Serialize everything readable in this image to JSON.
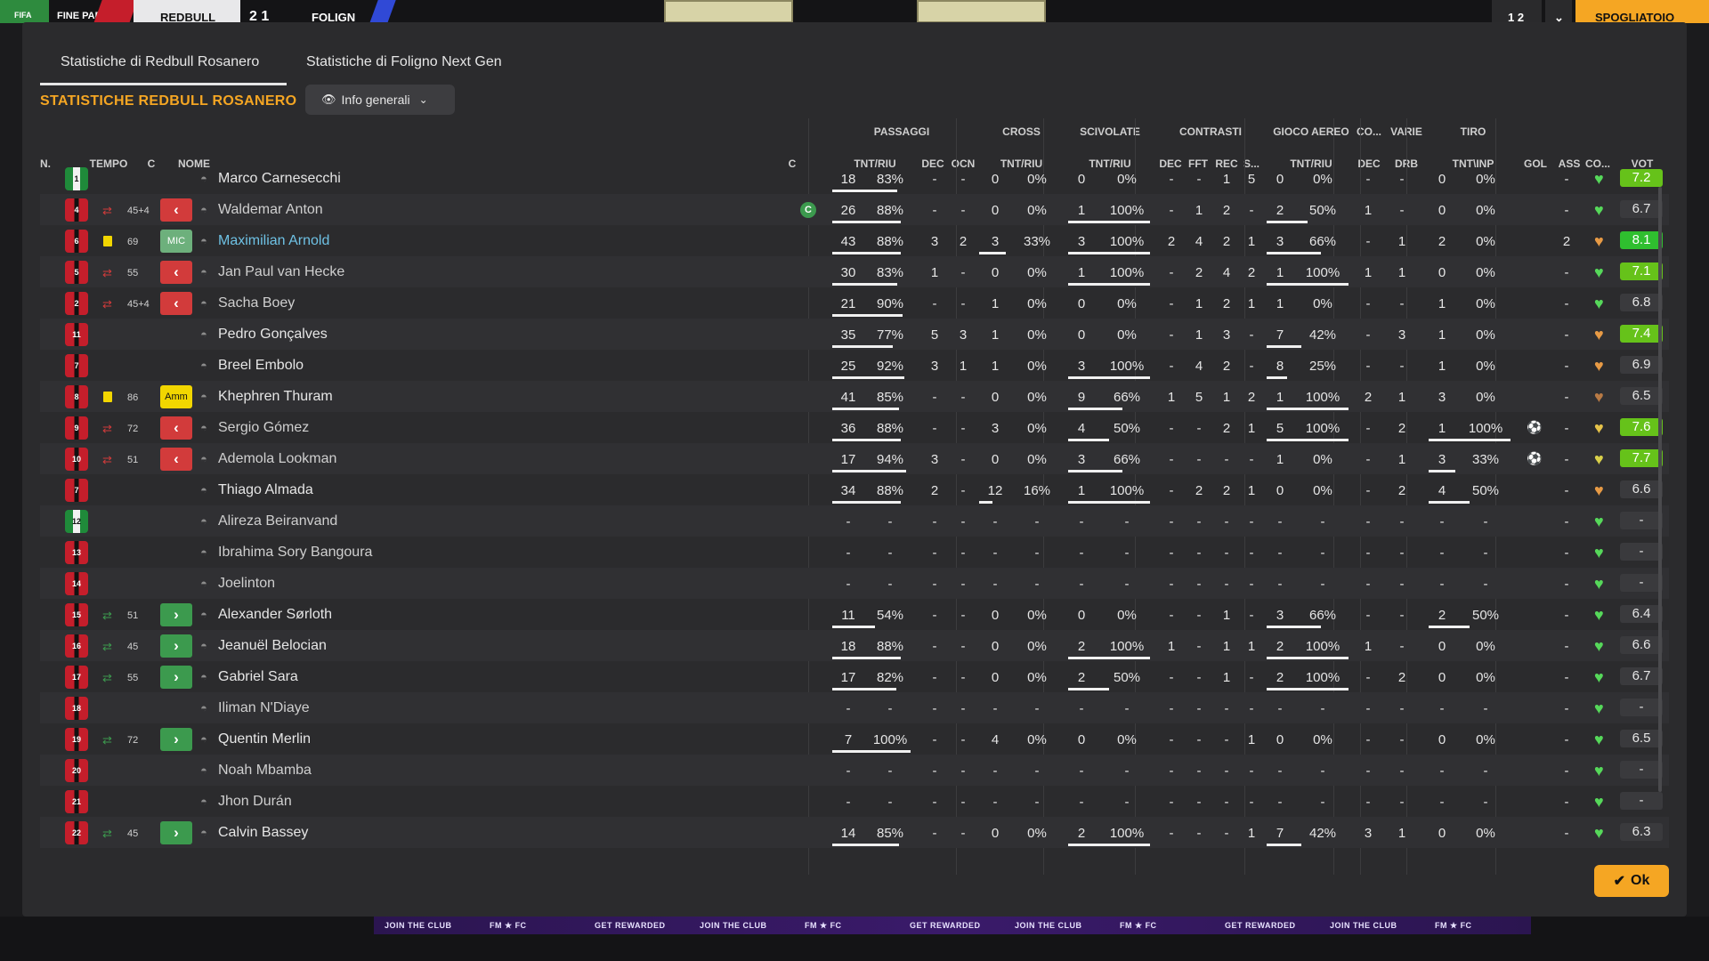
{
  "topbar": {
    "badge": "FIFA",
    "label": "FINE PARTITA",
    "home": "REDBULL",
    "score": "2 1",
    "away": "FOLIGN",
    "right_text": "1 2",
    "right_btn": "SPOGLIATOIO"
  },
  "tabs": [
    "Statistiche di Redbull Rosanero",
    "Statistiche di Foligno Next Gen"
  ],
  "section_title": "STATISTICHE REDBULL ROSANERO",
  "dropdown": {
    "label": "Info generali",
    "icon": "eye-icon"
  },
  "groups": [
    "PASSAGGI",
    "CROSS",
    "SCIVOLATE",
    "CONTRASTI",
    "GIOCO AEREO",
    "CO...",
    "VARIE",
    "TIRO"
  ],
  "columns": [
    "N.",
    "TEMPO",
    "C",
    "NOME",
    "C",
    "TNT/RIU",
    "DEC",
    "OCN",
    "TNT/RIU",
    "TNT/RIU",
    "DEC",
    "FFT",
    "REC",
    "S...",
    "TNT/RIU",
    "DEC",
    "DRB",
    "TNT\\INP",
    "GOL",
    "ASS",
    "CO...",
    "VOT"
  ],
  "players": [
    {
      "n": "1",
      "kit": "gk",
      "sub": "",
      "card": "",
      "min": "",
      "pos": "",
      "pos_style": "",
      "name": "Marco Carnesecchi",
      "name_style": "",
      "capt": "",
      "p1": "18",
      "p2": "83%",
      "pdec": "-",
      "pocn": "-",
      "c1": "0",
      "c2": "0%",
      "s1": "0",
      "s2": "0%",
      "cd": "-",
      "cf": "-",
      "cr": "1",
      "cs": "5",
      "a1": "0",
      "a2": "0%",
      "co": "-",
      "drb": "-",
      "t1": "0",
      "t2": "0%",
      "gol": "",
      "ass": "-",
      "heart": "green",
      "vot": "7.2",
      "vstyle": "good",
      "pbar": 0.83,
      "sbar": 0,
      "abar": 0,
      "tbar": 0,
      "cbar": 0
    },
    {
      "n": "4",
      "kit": "",
      "sub": "out",
      "card": "",
      "min": "45+4",
      "pos": "<",
      "pos_style": "red",
      "name": "Waldemar Anton",
      "name_style": "dim",
      "capt": "C",
      "p1": "26",
      "p2": "88%",
      "pdec": "-",
      "pocn": "-",
      "c1": "0",
      "c2": "0%",
      "s1": "1",
      "s2": "100%",
      "cd": "-",
      "cf": "1",
      "cr": "2",
      "cs": "-",
      "a1": "2",
      "a2": "50%",
      "co": "1",
      "drb": "-",
      "t1": "0",
      "t2": "0%",
      "gol": "",
      "ass": "-",
      "heart": "green",
      "vot": "6.7",
      "vstyle": "",
      "pbar": 0.88,
      "sbar": 1,
      "abar": 0.5,
      "tbar": 0,
      "cbar": 0
    },
    {
      "n": "6",
      "kit": "",
      "sub": "",
      "card": "yellow",
      "min": "69",
      "pos": "MIC",
      "pos_style": "mic",
      "name": "Maximilian Arnold",
      "name_style": "blue",
      "capt": "",
      "p1": "43",
      "p2": "88%",
      "pdec": "3",
      "pocn": "2",
      "c1": "3",
      "c2": "33%",
      "s1": "3",
      "s2": "100%",
      "cd": "2",
      "cf": "4",
      "cr": "2",
      "cs": "1",
      "a1": "3",
      "a2": "66%",
      "co": "-",
      "drb": "1",
      "t1": "2",
      "t2": "0%",
      "gol": "",
      "ass": "2",
      "heart": "orange",
      "vot": "8.1",
      "vstyle": "great",
      "pbar": 0.88,
      "sbar": 1,
      "abar": 0.66,
      "tbar": 0,
      "cbar": 0.33
    },
    {
      "n": "5",
      "kit": "",
      "sub": "out",
      "card": "",
      "min": "55",
      "pos": "<",
      "pos_style": "red",
      "name": "Jan Paul van Hecke",
      "name_style": "dim",
      "capt": "",
      "p1": "30",
      "p2": "83%",
      "pdec": "1",
      "pocn": "-",
      "c1": "0",
      "c2": "0%",
      "s1": "1",
      "s2": "100%",
      "cd": "-",
      "cf": "2",
      "cr": "4",
      "cs": "2",
      "a1": "1",
      "a2": "100%",
      "co": "1",
      "drb": "1",
      "t1": "0",
      "t2": "0%",
      "gol": "",
      "ass": "-",
      "heart": "green",
      "vot": "7.1",
      "vstyle": "good",
      "pbar": 0.83,
      "sbar": 1,
      "abar": 1,
      "tbar": 0,
      "cbar": 0
    },
    {
      "n": "2",
      "kit": "",
      "sub": "out",
      "card": "",
      "min": "45+4",
      "pos": "<",
      "pos_style": "red",
      "name": "Sacha Boey",
      "name_style": "dim",
      "capt": "",
      "p1": "21",
      "p2": "90%",
      "pdec": "-",
      "pocn": "-",
      "c1": "1",
      "c2": "0%",
      "s1": "0",
      "s2": "0%",
      "cd": "-",
      "cf": "1",
      "cr": "2",
      "cs": "1",
      "a1": "1",
      "a2": "0%",
      "co": "-",
      "drb": "-",
      "t1": "1",
      "t2": "0%",
      "gol": "",
      "ass": "-",
      "heart": "green",
      "vot": "6.8",
      "vstyle": "",
      "pbar": 0.9,
      "sbar": 0,
      "abar": 0,
      "tbar": 0,
      "cbar": 0
    },
    {
      "n": "11",
      "kit": "",
      "sub": "",
      "card": "",
      "min": "",
      "pos": "",
      "pos_style": "",
      "name": "Pedro Gonçalves",
      "name_style": "",
      "capt": "",
      "p1": "35",
      "p2": "77%",
      "pdec": "5",
      "pocn": "3",
      "c1": "1",
      "c2": "0%",
      "s1": "0",
      "s2": "0%",
      "cd": "-",
      "cf": "1",
      "cr": "3",
      "cs": "-",
      "a1": "7",
      "a2": "42%",
      "co": "-",
      "drb": "3",
      "t1": "1",
      "t2": "0%",
      "gol": "",
      "ass": "-",
      "heart": "orange",
      "vot": "7.4",
      "vstyle": "good",
      "pbar": 0.77,
      "sbar": 0,
      "abar": 0.42,
      "tbar": 0,
      "cbar": 0
    },
    {
      "n": "7",
      "kit": "",
      "sub": "",
      "card": "",
      "min": "",
      "pos": "",
      "pos_style": "",
      "name": "Breel Embolo",
      "name_style": "",
      "capt": "",
      "p1": "25",
      "p2": "92%",
      "pdec": "3",
      "pocn": "1",
      "c1": "1",
      "c2": "0%",
      "s1": "3",
      "s2": "100%",
      "cd": "-",
      "cf": "4",
      "cr": "2",
      "cs": "-",
      "a1": "8",
      "a2": "25%",
      "co": "-",
      "drb": "-",
      "t1": "1",
      "t2": "0%",
      "gol": "",
      "ass": "-",
      "heart": "orange",
      "vot": "6.9",
      "vstyle": "",
      "pbar": 0.92,
      "sbar": 1,
      "abar": 0.25,
      "tbar": 0,
      "cbar": 0
    },
    {
      "n": "8",
      "kit": "",
      "sub": "",
      "card": "yellow",
      "min": "86",
      "pos": "Amm",
      "pos_style": "amm",
      "name": "Khephren Thuram",
      "name_style": "",
      "capt": "",
      "p1": "41",
      "p2": "85%",
      "pdec": "-",
      "pocn": "-",
      "c1": "0",
      "c2": "0%",
      "s1": "9",
      "s2": "66%",
      "cd": "1",
      "cf": "5",
      "cr": "1",
      "cs": "2",
      "a1": "1",
      "a2": "100%",
      "co": "2",
      "drb": "1",
      "t1": "3",
      "t2": "0%",
      "gol": "",
      "ass": "-",
      "heart": "brown",
      "vot": "6.5",
      "vstyle": "",
      "pbar": 0.85,
      "sbar": 0.66,
      "abar": 1,
      "tbar": 0,
      "cbar": 0
    },
    {
      "n": "9",
      "kit": "",
      "sub": "out",
      "card": "",
      "min": "72",
      "pos": "<",
      "pos_style": "red",
      "name": "Sergio Gómez",
      "name_style": "dim",
      "capt": "",
      "p1": "36",
      "p2": "88%",
      "pdec": "-",
      "pocn": "-",
      "c1": "3",
      "c2": "0%",
      "s1": "4",
      "s2": "50%",
      "cd": "-",
      "cf": "-",
      "cr": "2",
      "cs": "1",
      "a1": "5",
      "a2": "100%",
      "co": "-",
      "drb": "2",
      "t1": "1",
      "t2": "100%",
      "gol": "ball",
      "ass": "-",
      "heart": "gold",
      "vot": "7.6",
      "vstyle": "good",
      "pbar": 0.88,
      "sbar": 0.5,
      "abar": 1,
      "tbar": 1,
      "cbar": 0
    },
    {
      "n": "10",
      "kit": "",
      "sub": "out",
      "card": "",
      "min": "51",
      "pos": "<",
      "pos_style": "red",
      "name": "Ademola Lookman",
      "name_style": "dim",
      "capt": "",
      "p1": "17",
      "p2": "94%",
      "pdec": "3",
      "pocn": "-",
      "c1": "0",
      "c2": "0%",
      "s1": "3",
      "s2": "66%",
      "cd": "-",
      "cf": "-",
      "cr": "-",
      "cs": "-",
      "a1": "1",
      "a2": "0%",
      "co": "-",
      "drb": "1",
      "t1": "3",
      "t2": "33%",
      "gol": "ball",
      "ass": "-",
      "heart": "yellow",
      "vot": "7.7",
      "vstyle": "good",
      "pbar": 0.94,
      "sbar": 0.66,
      "abar": 0,
      "tbar": 0.33,
      "cbar": 0
    },
    {
      "n": "7",
      "kit": "",
      "sub": "",
      "card": "",
      "min": "",
      "pos": "",
      "pos_style": "",
      "name": "Thiago Almada",
      "name_style": "",
      "capt": "",
      "p1": "34",
      "p2": "88%",
      "pdec": "2",
      "pocn": "-",
      "c1": "12",
      "c2": "16%",
      "s1": "1",
      "s2": "100%",
      "cd": "-",
      "cf": "2",
      "cr": "2",
      "cs": "1",
      "a1": "0",
      "a2": "0%",
      "co": "-",
      "drb": "2",
      "t1": "4",
      "t2": "50%",
      "gol": "",
      "ass": "-",
      "heart": "orange",
      "vot": "6.6",
      "vstyle": "",
      "pbar": 0.88,
      "sbar": 1,
      "abar": 0,
      "tbar": 0.5,
      "cbar": 0.16
    },
    {
      "n": "12",
      "kit": "gk",
      "sub": "",
      "card": "",
      "min": "",
      "pos": "",
      "pos_style": "",
      "name": "Alireza Beiranvand",
      "name_style": "dim",
      "capt": "",
      "p1": "-",
      "p2": "-",
      "pdec": "-",
      "pocn": "-",
      "c1": "-",
      "c2": "-",
      "s1": "-",
      "s2": "-",
      "cd": "-",
      "cf": "-",
      "cr": "-",
      "cs": "-",
      "a1": "-",
      "a2": "-",
      "co": "-",
      "drb": "-",
      "t1": "-",
      "t2": "-",
      "gol": "",
      "ass": "-",
      "heart": "green",
      "vot": "-",
      "vstyle": "",
      "pbar": 0,
      "sbar": 0,
      "abar": 0,
      "tbar": 0,
      "cbar": 0
    },
    {
      "n": "13",
      "kit": "",
      "sub": "",
      "card": "",
      "min": "",
      "pos": "",
      "pos_style": "",
      "name": "Ibrahima Sory Bangoura",
      "name_style": "dim",
      "capt": "",
      "p1": "-",
      "p2": "-",
      "pdec": "-",
      "pocn": "-",
      "c1": "-",
      "c2": "-",
      "s1": "-",
      "s2": "-",
      "cd": "-",
      "cf": "-",
      "cr": "-",
      "cs": "-",
      "a1": "-",
      "a2": "-",
      "co": "-",
      "drb": "-",
      "t1": "-",
      "t2": "-",
      "gol": "",
      "ass": "-",
      "heart": "green",
      "vot": "-",
      "vstyle": "",
      "pbar": 0,
      "sbar": 0,
      "abar": 0,
      "tbar": 0,
      "cbar": 0
    },
    {
      "n": "14",
      "kit": "",
      "sub": "",
      "card": "",
      "min": "",
      "pos": "",
      "pos_style": "",
      "name": "Joelinton",
      "name_style": "dim",
      "capt": "",
      "p1": "-",
      "p2": "-",
      "pdec": "-",
      "pocn": "-",
      "c1": "-",
      "c2": "-",
      "s1": "-",
      "s2": "-",
      "cd": "-",
      "cf": "-",
      "cr": "-",
      "cs": "-",
      "a1": "-",
      "a2": "-",
      "co": "-",
      "drb": "-",
      "t1": "-",
      "t2": "-",
      "gol": "",
      "ass": "-",
      "heart": "green",
      "vot": "-",
      "vstyle": "",
      "pbar": 0,
      "sbar": 0,
      "abar": 0,
      "tbar": 0,
      "cbar": 0
    },
    {
      "n": "15",
      "kit": "",
      "sub": "in",
      "card": "",
      "min": "51",
      "pos": ">",
      "pos_style": "green",
      "name": "Alexander Sørloth",
      "name_style": "",
      "capt": "",
      "p1": "11",
      "p2": "54%",
      "pdec": "-",
      "pocn": "-",
      "c1": "0",
      "c2": "0%",
      "s1": "0",
      "s2": "0%",
      "cd": "-",
      "cf": "-",
      "cr": "1",
      "cs": "-",
      "a1": "3",
      "a2": "66%",
      "co": "-",
      "drb": "-",
      "t1": "2",
      "t2": "50%",
      "gol": "",
      "ass": "-",
      "heart": "green",
      "vot": "6.4",
      "vstyle": "",
      "pbar": 0.54,
      "sbar": 0,
      "abar": 0.66,
      "tbar": 0.5,
      "cbar": 0
    },
    {
      "n": "16",
      "kit": "",
      "sub": "in",
      "card": "",
      "min": "45",
      "pos": ">",
      "pos_style": "green",
      "name": "Jeanuël Belocian",
      "name_style": "",
      "capt": "",
      "p1": "18",
      "p2": "88%",
      "pdec": "-",
      "pocn": "-",
      "c1": "0",
      "c2": "0%",
      "s1": "2",
      "s2": "100%",
      "cd": "1",
      "cf": "-",
      "cr": "1",
      "cs": "1",
      "a1": "2",
      "a2": "100%",
      "co": "1",
      "drb": "-",
      "t1": "0",
      "t2": "0%",
      "gol": "",
      "ass": "-",
      "heart": "green",
      "vot": "6.6",
      "vstyle": "",
      "pbar": 0.88,
      "sbar": 1,
      "abar": 1,
      "tbar": 0,
      "cbar": 0
    },
    {
      "n": "17",
      "kit": "",
      "sub": "in",
      "card": "",
      "min": "55",
      "pos": ">",
      "pos_style": "green",
      "name": "Gabriel Sara",
      "name_style": "",
      "capt": "",
      "p1": "17",
      "p2": "82%",
      "pdec": "-",
      "pocn": "-",
      "c1": "0",
      "c2": "0%",
      "s1": "2",
      "s2": "50%",
      "cd": "-",
      "cf": "-",
      "cr": "1",
      "cs": "-",
      "a1": "2",
      "a2": "100%",
      "co": "-",
      "drb": "2",
      "t1": "0",
      "t2": "0%",
      "gol": "",
      "ass": "-",
      "heart": "green",
      "vot": "6.7",
      "vstyle": "",
      "pbar": 0.82,
      "sbar": 0.5,
      "abar": 1,
      "tbar": 0,
      "cbar": 0
    },
    {
      "n": "18",
      "kit": "",
      "sub": "",
      "card": "",
      "min": "",
      "pos": "",
      "pos_style": "",
      "name": "Iliman N'Diaye",
      "name_style": "dim",
      "capt": "",
      "p1": "-",
      "p2": "-",
      "pdec": "-",
      "pocn": "-",
      "c1": "-",
      "c2": "-",
      "s1": "-",
      "s2": "-",
      "cd": "-",
      "cf": "-",
      "cr": "-",
      "cs": "-",
      "a1": "-",
      "a2": "-",
      "co": "-",
      "drb": "-",
      "t1": "-",
      "t2": "-",
      "gol": "",
      "ass": "-",
      "heart": "green",
      "vot": "-",
      "vstyle": "",
      "pbar": 0,
      "sbar": 0,
      "abar": 0,
      "tbar": 0,
      "cbar": 0
    },
    {
      "n": "19",
      "kit": "",
      "sub": "in",
      "card": "",
      "min": "72",
      "pos": ">",
      "pos_style": "green",
      "name": "Quentin Merlin",
      "name_style": "",
      "capt": "",
      "p1": "7",
      "p2": "100%",
      "pdec": "-",
      "pocn": "-",
      "c1": "4",
      "c2": "0%",
      "s1": "0",
      "s2": "0%",
      "cd": "-",
      "cf": "-",
      "cr": "-",
      "cs": "1",
      "a1": "0",
      "a2": "0%",
      "co": "-",
      "drb": "-",
      "t1": "0",
      "t2": "0%",
      "gol": "",
      "ass": "-",
      "heart": "green",
      "vot": "6.5",
      "vstyle": "",
      "pbar": 1,
      "sbar": 0,
      "abar": 0,
      "tbar": 0,
      "cbar": 0
    },
    {
      "n": "20",
      "kit": "",
      "sub": "",
      "card": "",
      "min": "",
      "pos": "",
      "pos_style": "",
      "name": "Noah Mbamba",
      "name_style": "dim",
      "capt": "",
      "p1": "-",
      "p2": "-",
      "pdec": "-",
      "pocn": "-",
      "c1": "-",
      "c2": "-",
      "s1": "-",
      "s2": "-",
      "cd": "-",
      "cf": "-",
      "cr": "-",
      "cs": "-",
      "a1": "-",
      "a2": "-",
      "co": "-",
      "drb": "-",
      "t1": "-",
      "t2": "-",
      "gol": "",
      "ass": "-",
      "heart": "green",
      "vot": "-",
      "vstyle": "",
      "pbar": 0,
      "sbar": 0,
      "abar": 0,
      "tbar": 0,
      "cbar": 0
    },
    {
      "n": "21",
      "kit": "",
      "sub": "",
      "card": "",
      "min": "",
      "pos": "",
      "pos_style": "",
      "name": "Jhon Durán",
      "name_style": "dim",
      "capt": "",
      "p1": "-",
      "p2": "-",
      "pdec": "-",
      "pocn": "-",
      "c1": "-",
      "c2": "-",
      "s1": "-",
      "s2": "-",
      "cd": "-",
      "cf": "-",
      "cr": "-",
      "cs": "-",
      "a1": "-",
      "a2": "-",
      "co": "-",
      "drb": "-",
      "t1": "-",
      "t2": "-",
      "gol": "",
      "ass": "-",
      "heart": "green",
      "vot": "-",
      "vstyle": "",
      "pbar": 0,
      "sbar": 0,
      "abar": 0,
      "tbar": 0,
      "cbar": 0
    },
    {
      "n": "22",
      "kit": "",
      "sub": "in",
      "card": "",
      "min": "45",
      "pos": ">",
      "pos_style": "green",
      "name": "Calvin Bassey",
      "name_style": "",
      "capt": "",
      "p1": "14",
      "p2": "85%",
      "pdec": "-",
      "pocn": "-",
      "c1": "0",
      "c2": "0%",
      "s1": "2",
      "s2": "100%",
      "cd": "-",
      "cf": "-",
      "cr": "-",
      "cs": "1",
      "a1": "7",
      "a2": "42%",
      "co": "3",
      "drb": "1",
      "t1": "0",
      "t2": "0%",
      "gol": "",
      "ass": "-",
      "heart": "green",
      "vot": "6.3",
      "vstyle": "",
      "pbar": 0.85,
      "sbar": 1,
      "abar": 0.42,
      "tbar": 0,
      "cbar": 0
    }
  ],
  "ok_button": "Ok",
  "bottom_strip": [
    "JOIN THE CLUB",
    "FM ★ FC",
    "GET REWARDED",
    "JOIN THE CLUB",
    "FM ★ FC",
    "GET REWARDED",
    "JOIN THE CLUB",
    "FM ★ FC",
    "GET REWARDED",
    "JOIN THE CLUB",
    "FM ★ FC"
  ],
  "colors": {
    "accent": "#f5a623",
    "good_rating": "#66c21a",
    "sub_out": "#d23b3b",
    "sub_in": "#3c9a4e",
    "highlight_name": "#6ec1e4"
  }
}
